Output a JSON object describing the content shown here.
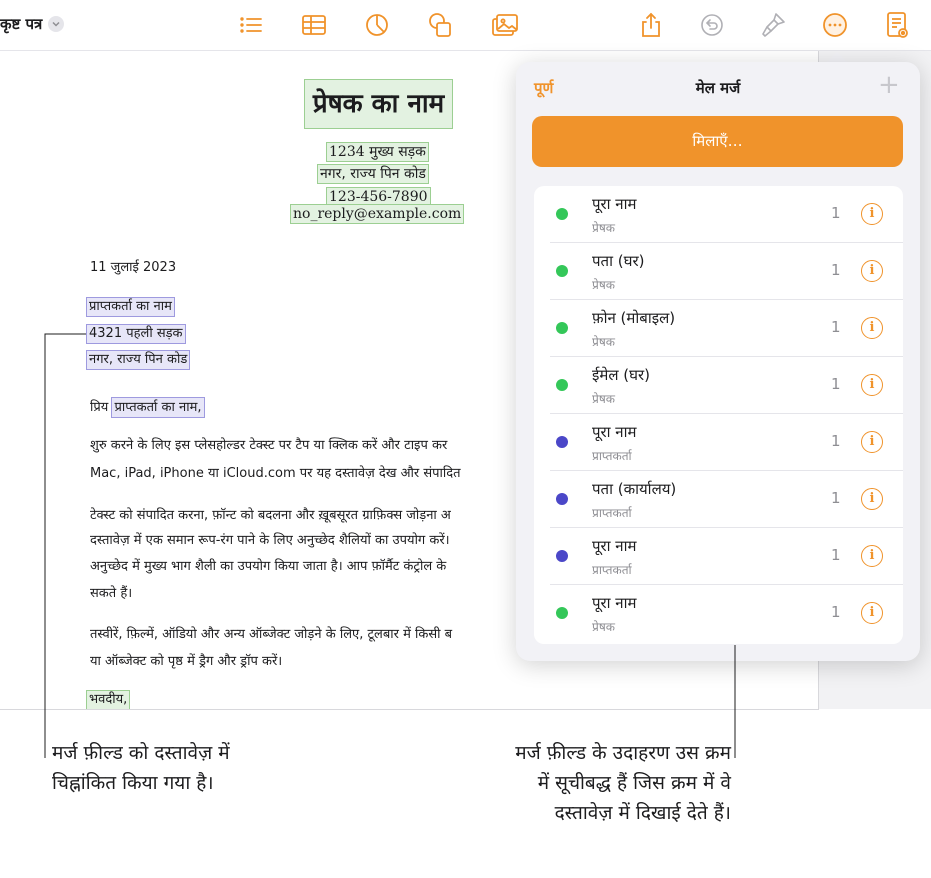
{
  "toolbar": {
    "doc_title": "कृष्ट पत्र",
    "icons": [
      "list-icon",
      "table-icon",
      "chart-icon",
      "shape-icon",
      "media-icon",
      "share-icon",
      "undo-icon",
      "format-brush-icon",
      "more-icon",
      "document-view-icon"
    ]
  },
  "document": {
    "sender_name": "प्रेषक का नाम",
    "sender_street": "1234 मुख्य सड़क",
    "sender_city": "नगर, राज्य पिन कोड",
    "sender_phone": "123-456-7890",
    "sender_email": "no_reply@example.com",
    "date": "11 जुलाई 2023",
    "recipient_name": "प्राप्तकर्ता का नाम",
    "recipient_street": "4321 पहली सड़क",
    "recipient_city": "नगर, राज्य पिन कोड",
    "salutation_prefix": "प्रिय",
    "salutation_field": "प्राप्तकर्ता का नाम,",
    "para1_line1": "शुरु करने के लिए इस प्लेसहोल्डर टेक्स्ट पर टैप या क्लिक करें और टाइप कर",
    "para1_line2": "Mac, iPad, iPhone या iCloud.com पर यह दस्तावेज़ देख और संपादित",
    "para2_line1": "टेक्स्ट को संपादित करना, फ़ॉन्ट को बदलना और ख़ूबसूरत ग्राफ़िक्स जोड़ना अ",
    "para2_line2": "दस्तावेज़ में एक समान रूप-रंग पाने के लिए अनुच्छेद शैलियों का उपयोग करें।",
    "para2_line3": "अनुच्छेद में मुख्य भाग शैली का उपयोग किया जाता है। आप फ़ॉर्मैट कंट्रोल के",
    "para2_line4": "सकते हैं।",
    "para3_line1": "तस्वीरें, फ़िल्में, ऑडियो और अन्य ऑब्जेक्ट जोड़ने के लिए, टूलबार में किसी ब",
    "para3_line2": "या ऑब्जेक्ट को पृष्ठ में ड्रैग और ड्रॉप करें।",
    "closing": "भवदीय,"
  },
  "popover": {
    "done_label": "पूर्ण",
    "title": "मेल मर्ज",
    "add_label": "+",
    "merge_button": "मिलाएँ…",
    "rows": [
      {
        "title": "पूरा नाम",
        "subtitle": "प्रेषक",
        "count": "1",
        "color": "#34c759"
      },
      {
        "title": "पता (घर)",
        "subtitle": "प्रेषक",
        "count": "1",
        "color": "#34c759"
      },
      {
        "title": "फ़ोन (मोबाइल)",
        "subtitle": "प्रेषक",
        "count": "1",
        "color": "#34c759"
      },
      {
        "title": "ईमेल (घर)",
        "subtitle": "प्रेषक",
        "count": "1",
        "color": "#34c759"
      },
      {
        "title": "पूरा नाम",
        "subtitle": "प्राप्तकर्ता",
        "count": "1",
        "color": "#4b47c8"
      },
      {
        "title": "पता (कार्यालय)",
        "subtitle": "प्राप्तकर्ता",
        "count": "1",
        "color": "#4b47c8"
      },
      {
        "title": "पूरा नाम",
        "subtitle": "प्राप्तकर्ता",
        "count": "1",
        "color": "#4b47c8"
      },
      {
        "title": "पूरा नाम",
        "subtitle": "प्रेषक",
        "count": "1",
        "color": "#34c759"
      }
    ]
  },
  "callouts": {
    "left_line1": "मर्ज फ़ील्ड को दस्तावेज़ में",
    "left_line2": "चिह्नांकित किया गया है।",
    "right_line1": "मर्ज फ़ील्ड के उदाहरण उस क्रम",
    "right_line2": "में सूचीबद्ध हैं जिस क्रम में वे",
    "right_line3": "दस्तावेज़ में दिखाई देते हैं।"
  },
  "colors": {
    "accent": "#f0932b",
    "sender_field": "#34c759",
    "recipient_field": "#4b47c8"
  }
}
